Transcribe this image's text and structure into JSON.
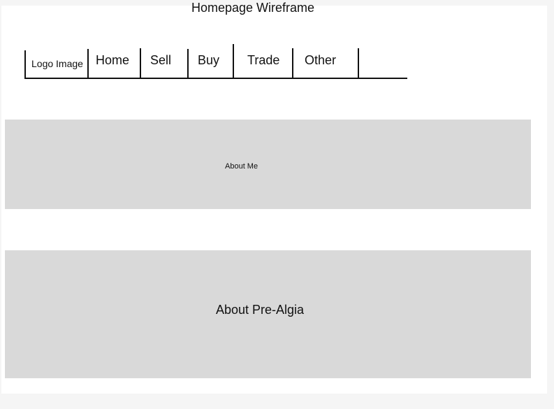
{
  "title": "Homepage Wireframe",
  "nav": {
    "logo": "Logo Image",
    "items": [
      "Home",
      "Sell",
      "Buy",
      "Trade",
      "Other"
    ]
  },
  "sections": {
    "about_me": "About Me",
    "about_pre_algia": "About Pre-Algia"
  },
  "colors": {
    "page_background": "#f5f5f5",
    "frame_background": "#ffffff",
    "placeholder_block": "#d9d9d9",
    "line": "#111111"
  }
}
